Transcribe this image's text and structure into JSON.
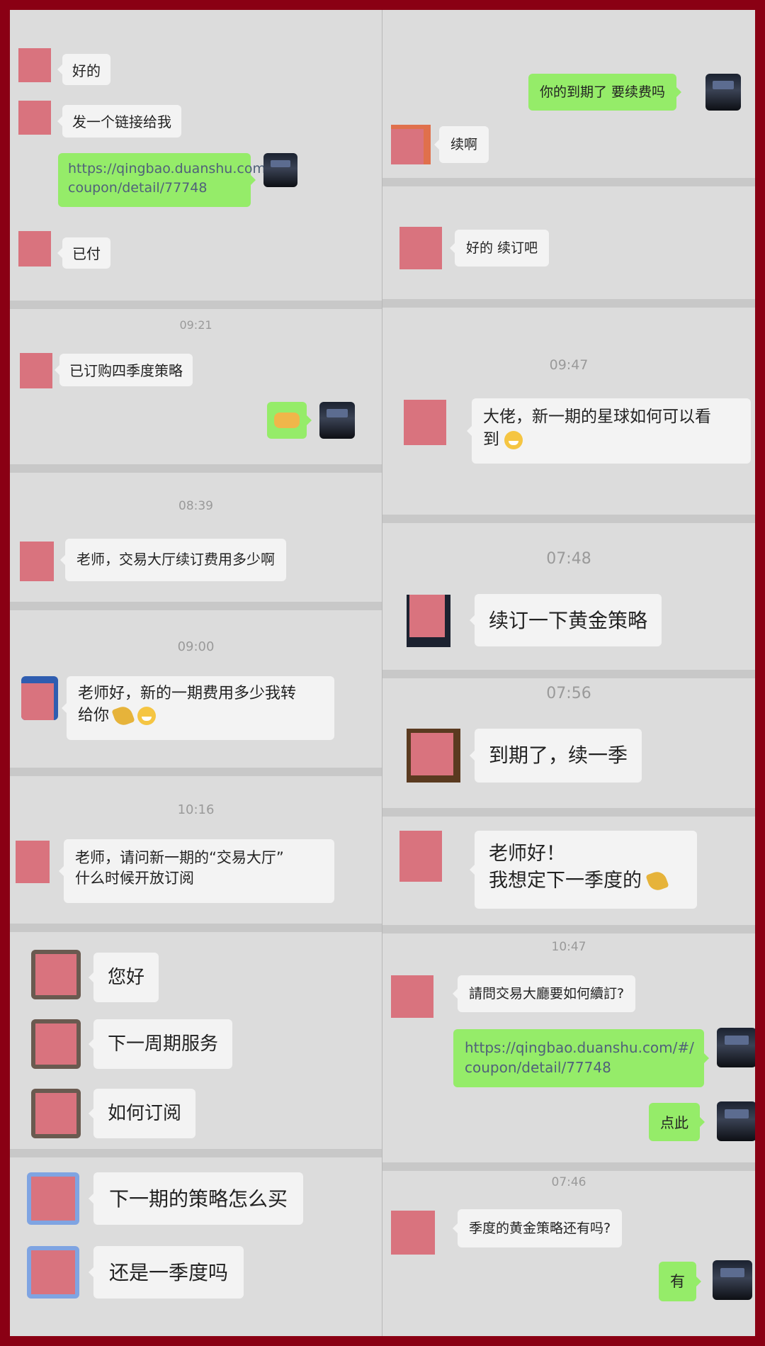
{
  "theme": {
    "frame_color": "#8a0014",
    "chat_bg": "#dcdcdc",
    "incoming_bubble": "#f3f3f3",
    "outgoing_bubble": "#95ec69",
    "link_color": "#50617a",
    "avatar_placeholder": "#d9737e"
  },
  "left": {
    "messages": {
      "m1": "好的",
      "m2": "发一个链接给我",
      "m3_line1": "https://qingbao.duanshu.com/#/",
      "m3_line2": "coupon/detail/77748",
      "m4": "已付",
      "m5": "已订购四季度策略",
      "m6_emoji": "handshake-emoji",
      "m7": "老师，交易大厅续订费用多少啊",
      "m8_line1": "老师好，新的一期费用多少我转",
      "m8_line2": "给你",
      "m9_line1": "老师，请问新一期的“交易大厅”",
      "m9_line2": "什么时候开放订阅",
      "m10": "您好",
      "m11": "下一周期服务",
      "m12": "如何订阅",
      "m13": "下一期的策略怎么买",
      "m14": "还是一季度吗"
    },
    "timestamps": {
      "t1": "09:21",
      "t2": "08:39",
      "t3": "09:00",
      "t4": "10:16"
    }
  },
  "right": {
    "messages": {
      "r1": "你的到期了 要续费吗",
      "r2": "续啊",
      "r3": "好的 续订吧",
      "r4_line1": "大佬，新一期的星球如何可以看",
      "r4_line2": "到",
      "r5": "续订一下黄金策略",
      "r6": "到期了，续一季",
      "r7_line1": "老师好！",
      "r7_line2": "我想定下一季度的",
      "r8": "請問交易大廳要如何續訂?",
      "r9_line1": "https://qingbao.duanshu.com/#/",
      "r9_line2": "coupon/detail/77748",
      "r10": "点此",
      "r11": "季度的黄金策略还有吗?",
      "r12": "有"
    },
    "timestamps": {
      "t1": "09:47",
      "t2": "07:48",
      "t3": "07:56",
      "t4": "10:47",
      "t5": "07:46"
    }
  }
}
